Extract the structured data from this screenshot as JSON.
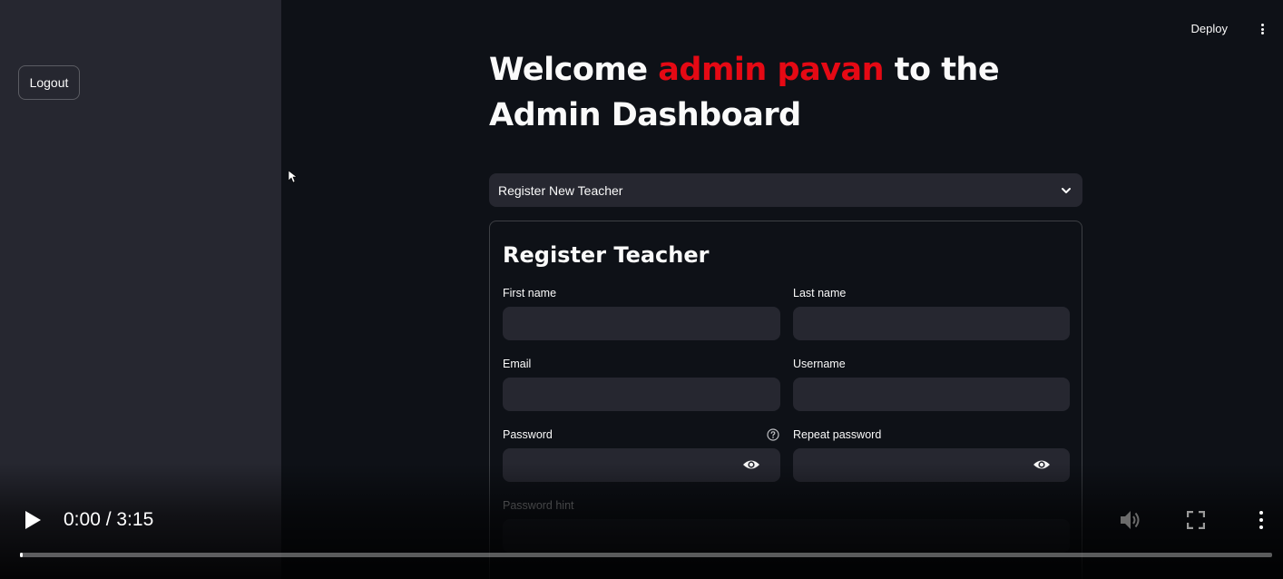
{
  "sidebar": {
    "logout_label": "Logout"
  },
  "header": {
    "deploy_label": "Deploy"
  },
  "page": {
    "title_prefix": "Welcome ",
    "title_name": "admin pavan",
    "title_suffix": " to the Admin Dashboard",
    "accent_color": "#e50914"
  },
  "expander": {
    "label": "Register New Teacher"
  },
  "form": {
    "title": "Register Teacher",
    "first_name": {
      "label": "First name",
      "value": ""
    },
    "last_name": {
      "label": "Last name",
      "value": ""
    },
    "email": {
      "label": "Email",
      "value": ""
    },
    "username": {
      "label": "Username",
      "value": ""
    },
    "password": {
      "label": "Password",
      "value": ""
    },
    "repeat_password": {
      "label": "Repeat password",
      "value": ""
    },
    "password_hint": {
      "label": "Password hint",
      "value": ""
    }
  },
  "video": {
    "time": "0:00 / 3:15",
    "progress": 0.001
  }
}
